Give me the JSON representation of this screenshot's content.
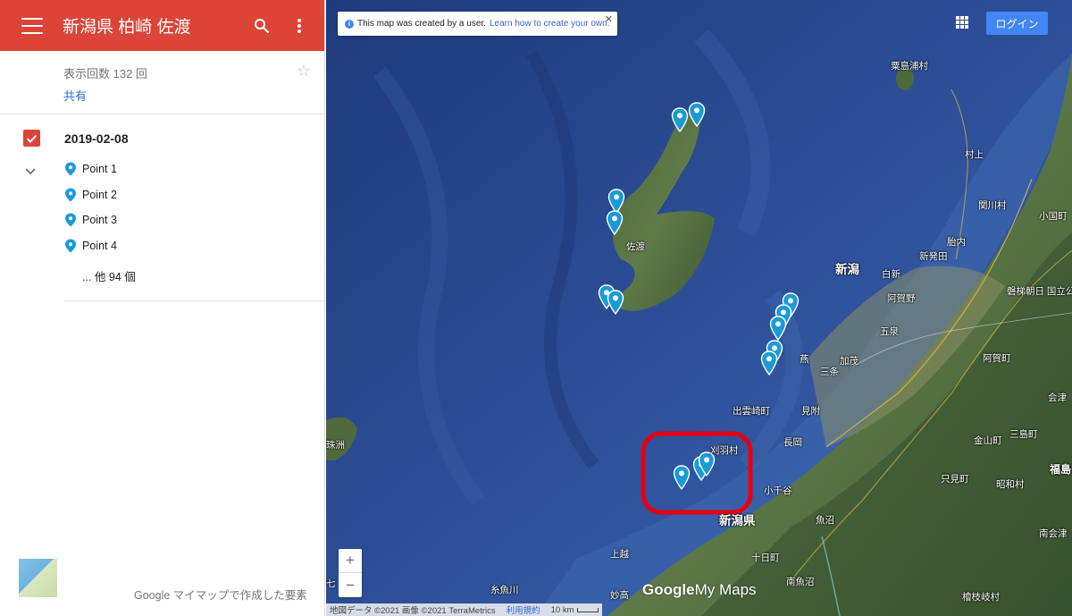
{
  "header": {
    "title": "新潟県 柏崎 佐渡"
  },
  "info": {
    "views": "表示回数 132 回",
    "share": "共有"
  },
  "layer": {
    "name": "2019-02-08",
    "items": [
      {
        "label": "Point 1"
      },
      {
        "label": "Point 2"
      },
      {
        "label": "Point 3"
      },
      {
        "label": "Point 4"
      }
    ],
    "more": "... 他 94 個"
  },
  "footer": {
    "text": "Google マイマップで作成した要素"
  },
  "map": {
    "notice_text": "This map was created by a user.",
    "notice_link": "Learn how to create your own.",
    "login_label": "ログイン",
    "attribution": "地図データ ©2021 画像 ©2021 TerraMetrics",
    "terms": "利用規約",
    "scale": "10 km",
    "logo_google": "Google",
    "logo_mymaps": "My Maps",
    "labels": {
      "sado": "佐渡",
      "niigata_city": "新潟",
      "niigata_pref": "新潟県",
      "awashimaura": "粟島浦村",
      "murakami": "村上",
      "sekikawa": "関川村",
      "oguni": "小国町",
      "tainai": "胎内",
      "shibata": "新発田",
      "shirone": "白新",
      "agano": "阿賀野",
      "bandai": "磐梯朝日\n国立公園",
      "gosen": "五泉",
      "agamachi": "阿賀町",
      "kamo": "加茂",
      "sanjo": "三条",
      "tsubame": "燕",
      "izumozaki": "出雲崎町",
      "mitsuke": "見附",
      "nagaoka": "長岡",
      "kariwa": "刈羽村",
      "ojiya": "小千谷",
      "uonuma": "魚沼",
      "tokamachi": "十日町",
      "minamiuonuma": "南魚沼",
      "itoigawa": "糸魚川",
      "myoko": "妙高",
      "joetsu": "上越",
      "tadami": "只見町",
      "kaneyama": "金山町",
      "showa": "昭和村",
      "minamiaizu": "南会津",
      "hinoemata": "檜枝岐村",
      "fukushima": "福島",
      "mishima": "三島町",
      "aizu": "会津",
      "sumiwa": "珠洲",
      "hiko": "七"
    }
  }
}
